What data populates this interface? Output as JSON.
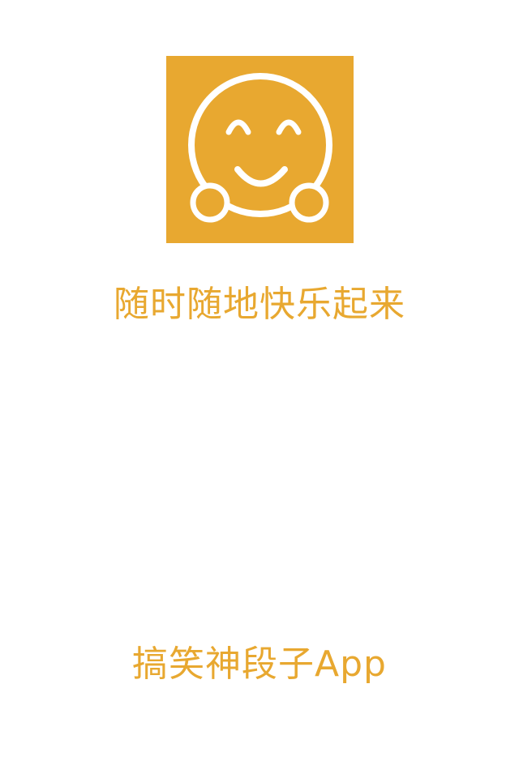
{
  "splash": {
    "logo_icon": "smiley-face-icon",
    "slogan": "随时随地快乐起来",
    "app_name": "搞笑神段子App"
  },
  "colors": {
    "brand": "#E8A830",
    "background": "#FFFFFF",
    "icon_stroke": "#FFFFFF"
  }
}
